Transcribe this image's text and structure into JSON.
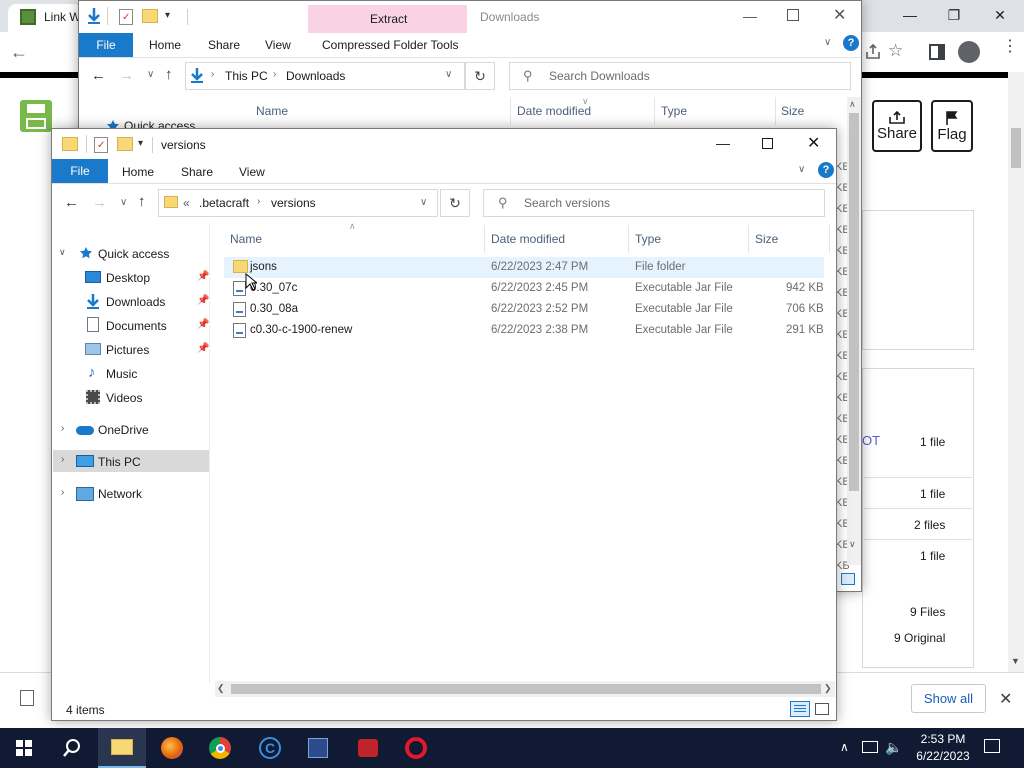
{
  "chrome": {
    "tab_title": "Link W",
    "share_label": "Share",
    "flag_label": "Flag",
    "rows": [
      {
        "left": "OT",
        "right": "1 file"
      },
      {
        "left": "",
        "right": "1 file"
      },
      {
        "left": "",
        "right": "2 files"
      },
      {
        "left": "",
        "right": "1 file"
      },
      {
        "left": "",
        "right": "9 Files"
      },
      {
        "left": "",
        "right": "9 Original"
      }
    ],
    "show_all": "Show all"
  },
  "downloads_window": {
    "title": "Downloads",
    "contextual_tab": "Extract",
    "ribbon_tabs": [
      "File",
      "Home",
      "Share",
      "View",
      "Compressed Folder Tools"
    ],
    "breadcrumb": [
      "This PC",
      "Downloads"
    ],
    "search_placeholder": "Search Downloads",
    "columns": [
      "Name",
      "Date modified",
      "Type",
      "Size"
    ],
    "quick_access": "Quick access",
    "size_fragments": [
      "KB",
      "KB",
      "KB",
      "KB",
      "KB",
      "KB",
      "KB",
      "KB",
      "KB",
      "KB",
      "KB",
      "KB",
      "KB",
      "KB",
      "KB",
      "KB",
      "KB",
      "KB",
      "KB",
      "KB"
    ]
  },
  "versions_window": {
    "title": "versions",
    "ribbon_tabs": [
      "File",
      "Home",
      "Share",
      "View"
    ],
    "breadcrumb": [
      ".betacraft",
      "versions"
    ],
    "breadcrumb_prefix": "«",
    "search_placeholder": "Search versions",
    "columns": [
      "Name",
      "Date modified",
      "Type",
      "Size"
    ],
    "nav": {
      "quick_access": "Quick access",
      "desktop": "Desktop",
      "downloads": "Downloads",
      "documents": "Documents",
      "pictures": "Pictures",
      "music": "Music",
      "videos": "Videos",
      "onedrive": "OneDrive",
      "this_pc": "This PC",
      "network": "Network"
    },
    "files": [
      {
        "name": "jsons",
        "date": "6/22/2023 2:47 PM",
        "type": "File folder",
        "size": "",
        "icon": "folder-icon"
      },
      {
        "name": "0.30_07c",
        "date": "6/22/2023 2:45 PM",
        "type": "Executable Jar File",
        "size": "942 KB",
        "icon": "jar-file-icon"
      },
      {
        "name": "0.30_08a",
        "date": "6/22/2023 2:52 PM",
        "type": "Executable Jar File",
        "size": "706 KB",
        "icon": "jar-file-icon"
      },
      {
        "name": "c0.30-c-1900-renew",
        "date": "6/22/2023 2:38 PM",
        "type": "Executable Jar File",
        "size": "291 KB",
        "icon": "jar-file-icon"
      }
    ],
    "status": "4 items"
  },
  "taskbar": {
    "time": "2:53 PM",
    "date": "6/22/2023"
  },
  "colors": {
    "accent_blue": "#1979ca",
    "selected_row": "#e5f3ff",
    "nav_selected": "#d9d9d9",
    "taskbar": "#101a33",
    "ribbon_contextual": "#f7c6d8"
  }
}
